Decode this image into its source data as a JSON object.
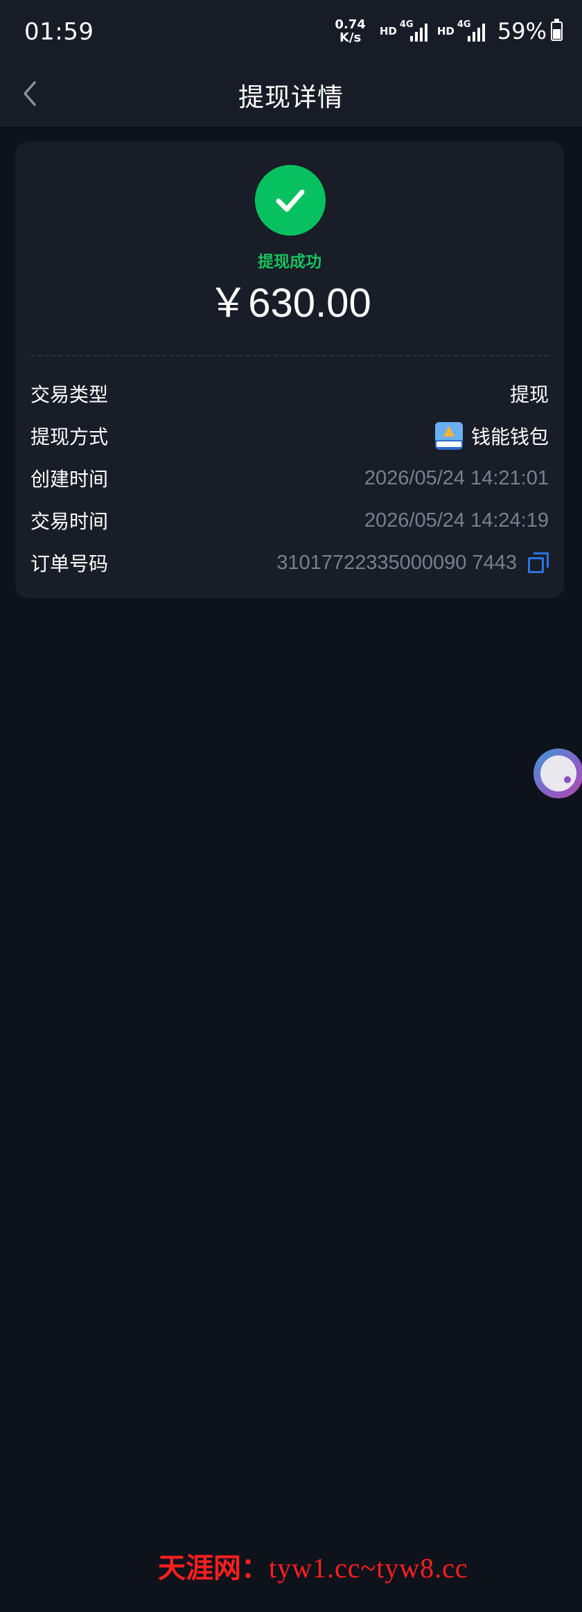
{
  "status_bar": {
    "time": "01:59",
    "net_speed_value": "0.74",
    "net_speed_unit": "K/s",
    "hd_label": "HD",
    "network_type": "4G",
    "battery": "59%"
  },
  "nav": {
    "title": "提现详情"
  },
  "result": {
    "status": "提现成功",
    "amount": "￥630.00",
    "status_color": "#07c160"
  },
  "details": [
    {
      "label": "交易类型",
      "value": "提现"
    },
    {
      "label": "提现方式",
      "value": "钱能钱包",
      "icon": "wallet-app-icon"
    },
    {
      "label": "创建时间",
      "value": "2026/05/24 14:21:01"
    },
    {
      "label": "交易时间",
      "value": "2026/05/24 14:24:19"
    },
    {
      "label": "订单号码",
      "value": "31017722335000090 7443",
      "icon": "copy-icon"
    }
  ],
  "watermark": {
    "cjk": "天涯网：",
    "latin": "tyw1.cc~tyw8.cc"
  },
  "icons": {
    "back": "chevron-left-icon",
    "success": "check-circle-icon",
    "float": "assistive-ball-icon"
  },
  "colors": {
    "background": "#0e121b",
    "card": "#181d27",
    "accent_green": "#07c160",
    "link_blue": "#2b74e8",
    "muted_text": "#79808d",
    "watermark": "#ff1f1f"
  }
}
